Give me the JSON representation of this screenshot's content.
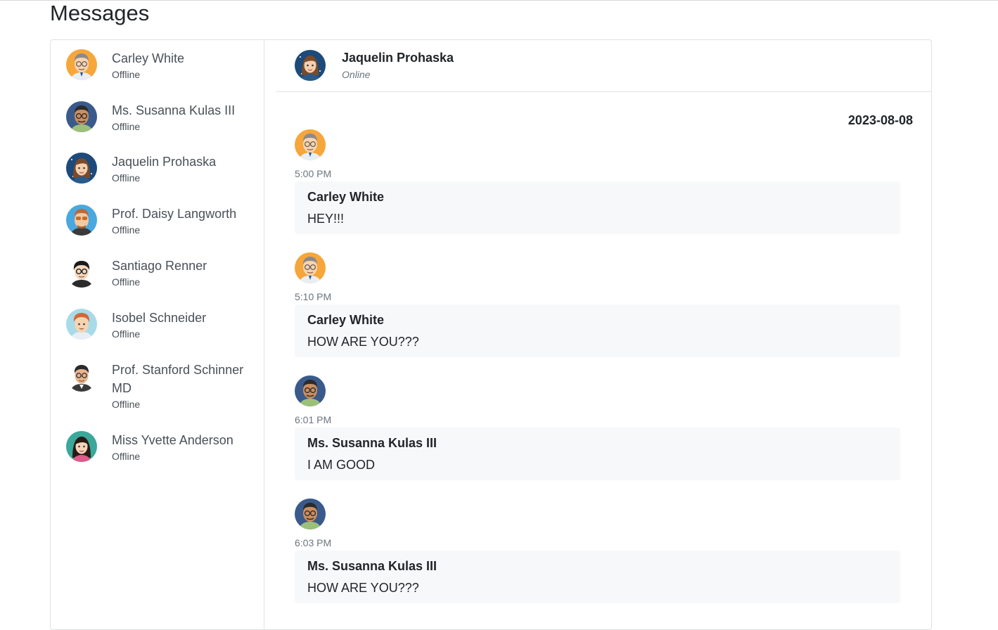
{
  "page": {
    "title": "Messages"
  },
  "contacts": [
    {
      "name": "Carley White",
      "status": "Offline",
      "avatar": "avatar-glasses-man"
    },
    {
      "name": "Ms. Susanna Kulas III",
      "status": "Offline",
      "avatar": "avatar-glasses-man-dark"
    },
    {
      "name": "Jaquelin Prohaska",
      "status": "Offline",
      "avatar": "avatar-woman-brown"
    },
    {
      "name": "Prof. Daisy Langworth",
      "status": "Offline",
      "avatar": "avatar-sunglasses-man"
    },
    {
      "name": "Santiago Renner",
      "status": "Offline",
      "avatar": "avatar-glasses-man-black"
    },
    {
      "name": "Isobel Schneider",
      "status": "Offline",
      "avatar": "avatar-redhead-man"
    },
    {
      "name": "Prof. Stanford Schinner MD",
      "status": "Offline",
      "avatar": "avatar-glasses-man-suit"
    },
    {
      "name": "Miss Yvette Anderson",
      "status": "Offline",
      "avatar": "avatar-woman-dark"
    }
  ],
  "chat": {
    "header": {
      "name": "Jaquelin Prohaska",
      "status": "Online",
      "avatar": "avatar-woman-brown"
    },
    "date": "2023-08-08",
    "messages": [
      {
        "time": "5:00 PM",
        "sender": "Carley White",
        "text": "HEY!!!",
        "avatar": "avatar-glasses-man"
      },
      {
        "time": "5:10 PM",
        "sender": "Carley White",
        "text": "HOW ARE YOU???",
        "avatar": "avatar-glasses-man"
      },
      {
        "time": "6:01 PM",
        "sender": "Ms. Susanna Kulas III",
        "text": "I AM GOOD",
        "avatar": "avatar-glasses-man-dark"
      },
      {
        "time": "6:03 PM",
        "sender": "Ms. Susanna Kulas III",
        "text": "HOW ARE YOU???",
        "avatar": "avatar-glasses-man-dark"
      }
    ]
  },
  "colors": {
    "bubble": "#f7f8f9",
    "border": "#dee2e6",
    "muted": "#6c757d"
  }
}
